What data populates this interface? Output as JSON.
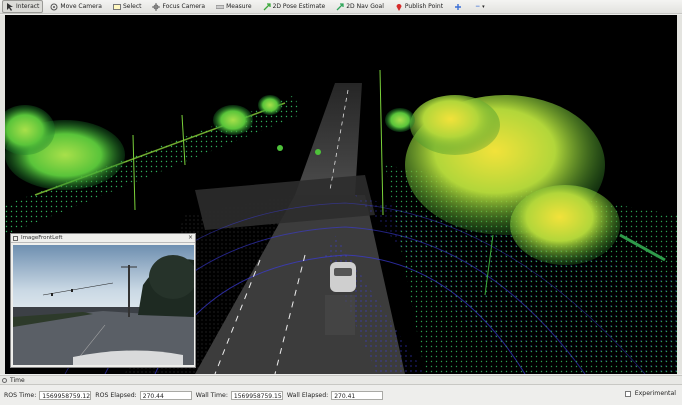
{
  "toolbar": {
    "interact": "Interact",
    "move_camera": "Move Camera",
    "select": "Select",
    "focus_camera": "Focus Camera",
    "measure": "Measure",
    "pose_estimate": "2D Pose Estimate",
    "nav_goal": "2D Nav Goal",
    "publish_point": "Publish Point",
    "more": "−"
  },
  "camera_window": {
    "title": "ImageFrontLeft",
    "close": "×"
  },
  "time_panel": {
    "title": "Time",
    "ros_time_label": "ROS Time:",
    "ros_time": "1569958759.12",
    "ros_elapsed_label": "ROS Elapsed:",
    "ros_elapsed": "270.44",
    "wall_time_label": "Wall Time:",
    "wall_time": "1569958759.15",
    "wall_elapsed_label": "Wall Elapsed:",
    "wall_elapsed": "270.41",
    "experimental_label": "Experimental"
  },
  "colors": {
    "accent_red": "#d62c2c",
    "pose_green": "#3aa83a",
    "cloud_green": "#7ad13a",
    "cloud_blue": "#4b4bff"
  }
}
